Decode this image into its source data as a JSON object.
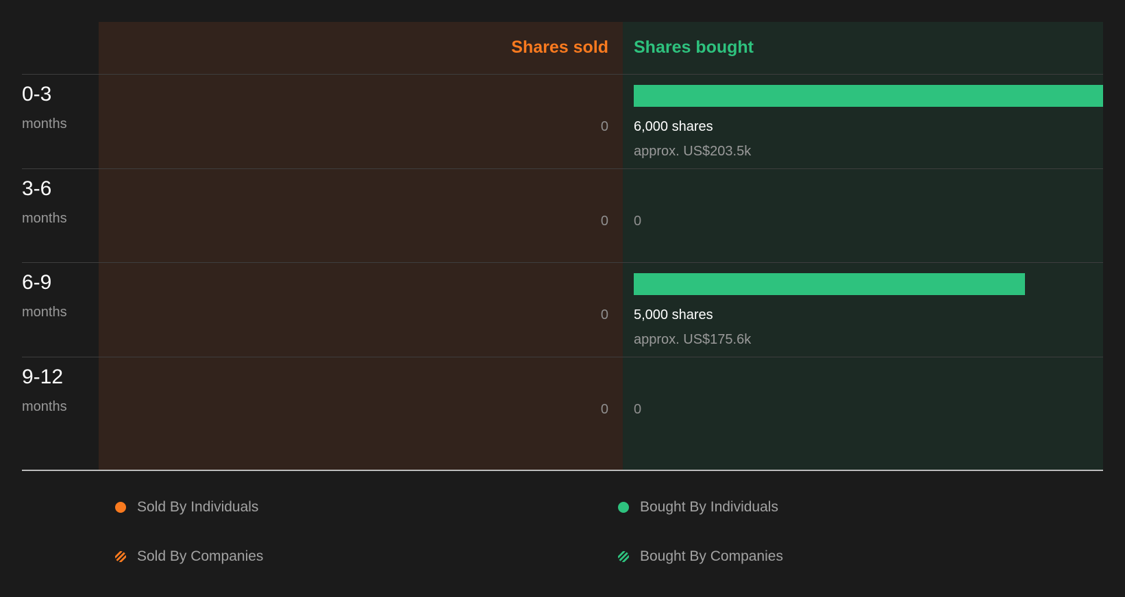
{
  "colors": {
    "sold": "#f97a1f",
    "bought": "#2ec27e"
  },
  "chart_data": {
    "type": "bar",
    "headers": {
      "sold": "Shares sold",
      "bought": "Shares bought"
    },
    "categories": [
      {
        "label": "0-3",
        "unit": "months"
      },
      {
        "label": "3-6",
        "unit": "months"
      },
      {
        "label": "6-9",
        "unit": "months"
      },
      {
        "label": "9-12",
        "unit": "months"
      }
    ],
    "series": [
      {
        "name": "Shares sold",
        "values": [
          0,
          0,
          0,
          0
        ],
        "display": [
          "0",
          "0",
          "0",
          "0"
        ]
      },
      {
        "name": "Shares bought",
        "values": [
          6000,
          0,
          5000,
          0
        ],
        "display": [
          "6,000 shares",
          "0",
          "5,000 shares",
          "0"
        ],
        "approx": [
          "approx. US$203.5k",
          "",
          "approx. US$175.6k",
          ""
        ]
      }
    ],
    "legend": [
      {
        "label": "Sold By Individuals",
        "style": "solid-sold"
      },
      {
        "label": "Bought By Individuals",
        "style": "solid-bought"
      },
      {
        "label": "Sold By Companies",
        "style": "striped-sold"
      },
      {
        "label": "Bought By Companies",
        "style": "striped-bought"
      }
    ],
    "legend_position": "bottom",
    "grid": false
  }
}
